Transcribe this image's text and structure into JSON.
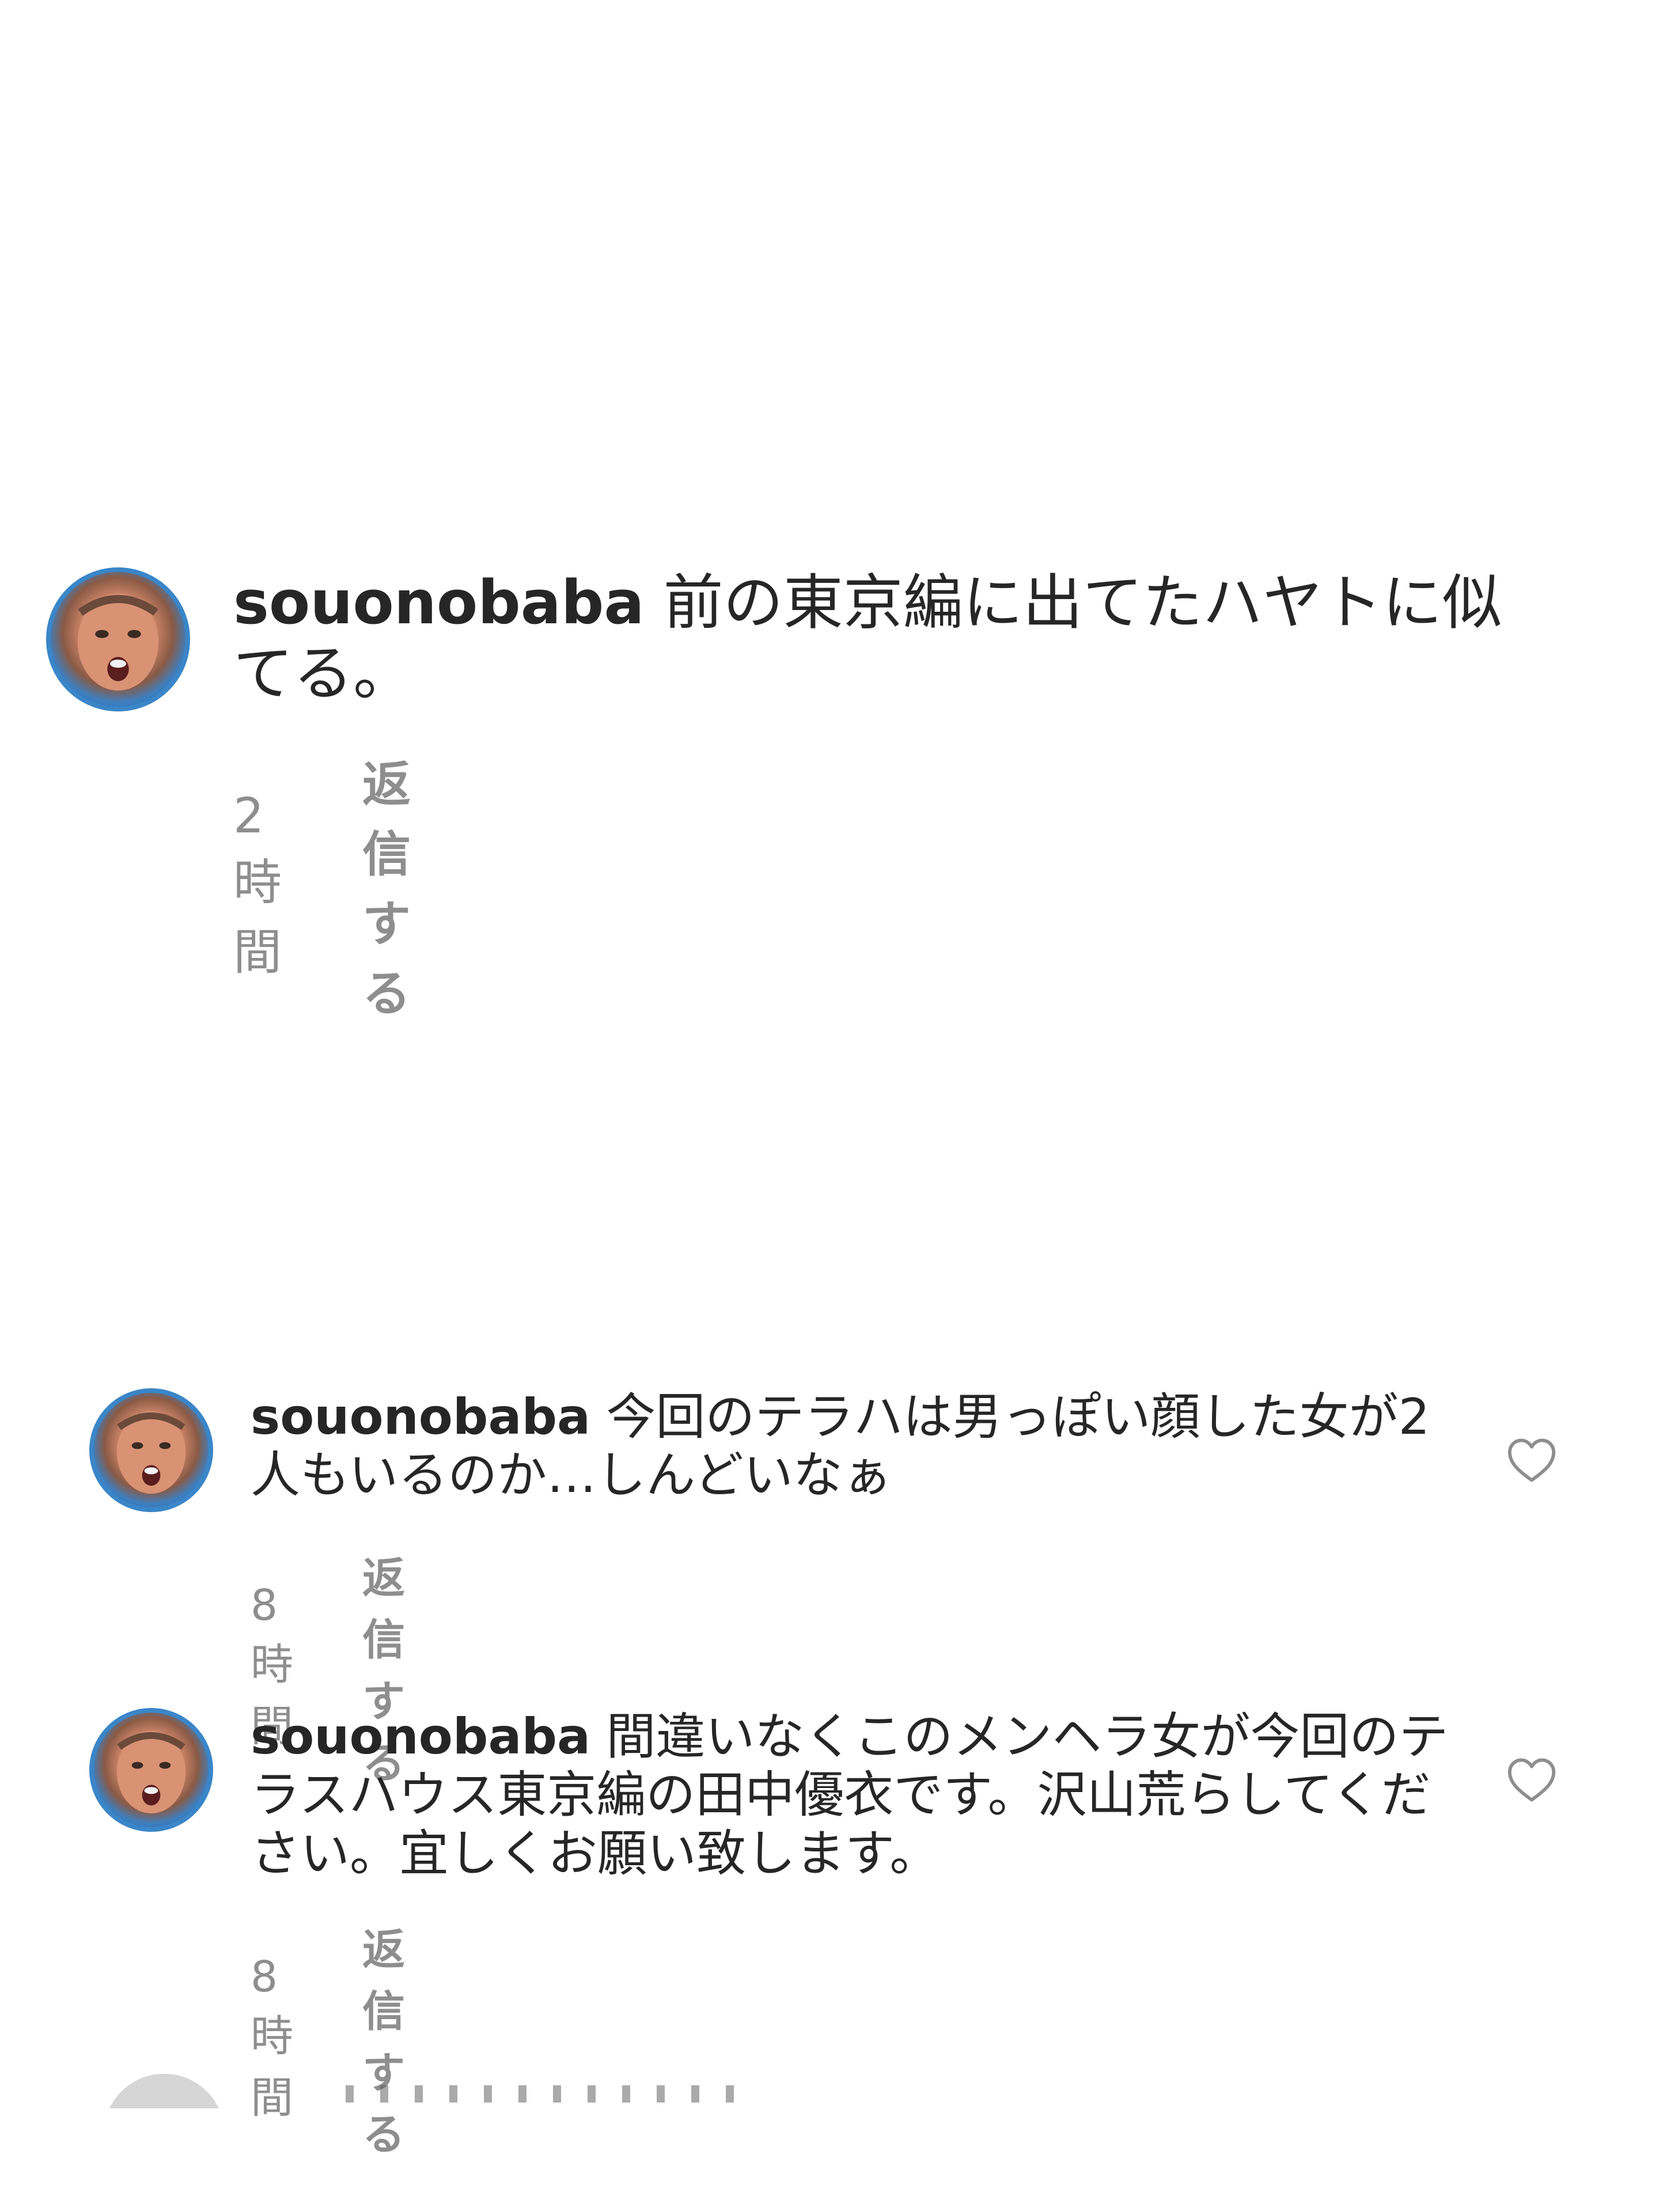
{
  "comments": [
    {
      "username": "souonobaba",
      "text": "前の東京編に出てたハヤトに似てる。",
      "time": "2時間",
      "reply": "返信する"
    },
    {
      "username": "souonobaba",
      "text": "今回のテラハは男っぽい顔した女が2人もいるのか…しんどいなぁ",
      "time": "8時間",
      "reply": "返信する"
    },
    {
      "username": "souonobaba",
      "text": "間違いなくこのメンヘラ女が今回のテラスハウス東京編の田中優衣です。沢山荒らしてください。宜しくお願い致します。",
      "time": "8時間",
      "reply": "返信する"
    }
  ],
  "icons": {
    "like": "heart-outline-icon",
    "avatar": "profile-avatar"
  },
  "colors": {
    "text": "#262626",
    "meta": "#8e8e8e",
    "background": "#ffffff"
  }
}
